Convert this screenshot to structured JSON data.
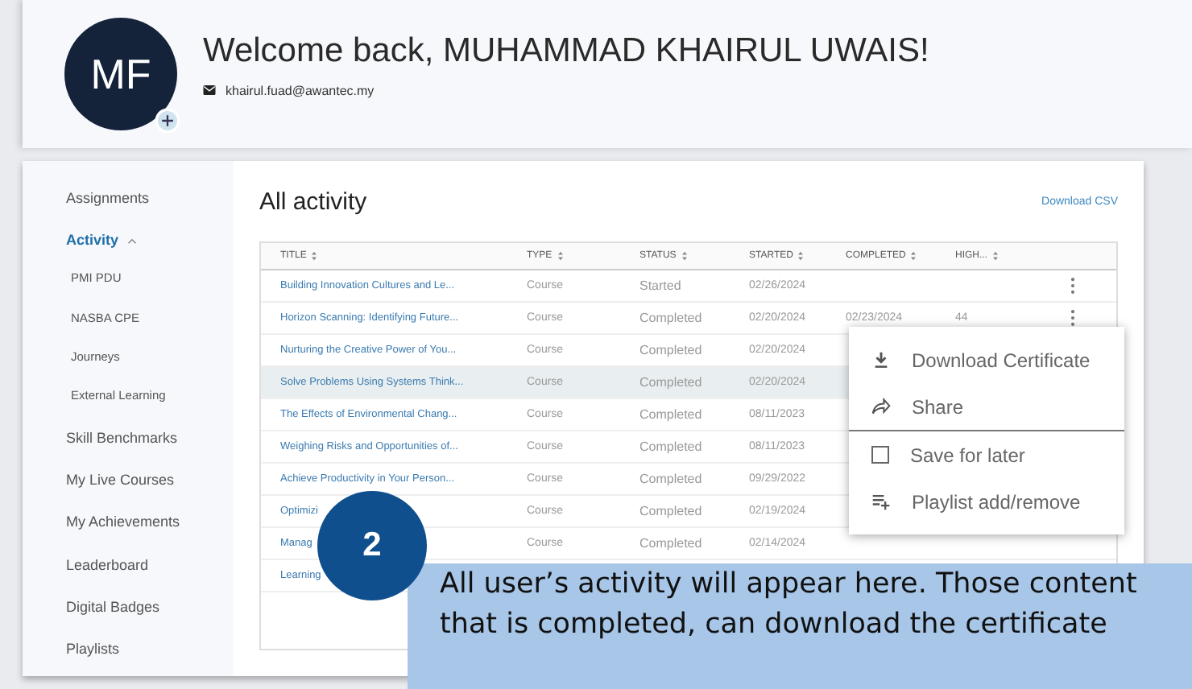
{
  "profile": {
    "initials": "MF",
    "greeting": "Welcome back, MUHAMMAD KHAIRUL UWAIS!",
    "email": "khairul.fuad@awantec.my"
  },
  "sidebar": {
    "items": [
      {
        "label": "Assignments",
        "selected": false
      },
      {
        "label": "Activity",
        "selected": true,
        "expanded": true,
        "children": [
          {
            "label": "PMI PDU",
            "selected": false
          },
          {
            "label": "NASBA CPE",
            "selected": false
          },
          {
            "label": "Journeys",
            "selected": false
          },
          {
            "label": "External Learning",
            "selected": false
          }
        ]
      },
      {
        "label": "Skill Benchmarks",
        "selected": false
      },
      {
        "label": "My Live Courses",
        "selected": false
      },
      {
        "label": "My Achievements",
        "selected": false
      },
      {
        "label": "Leaderboard",
        "selected": false
      },
      {
        "label": "Digital Badges",
        "selected": false
      },
      {
        "label": "Playlists",
        "selected": false
      }
    ]
  },
  "activity": {
    "title": "All activity",
    "download_link": "Download CSV",
    "table": {
      "columns": [
        "TITLE",
        "TYPE",
        "STATUS",
        "STARTED",
        "COMPLETED",
        "HIGH..."
      ],
      "rows": [
        {
          "cells": [
            "Building Innovation Cultures and Le...",
            "Course",
            "Started",
            "02/26/2024",
            "",
            ""
          ],
          "selected": false,
          "menu_icon": true
        },
        {
          "cells": [
            "Horizon Scanning: Identifying Future...",
            "Course",
            "Completed",
            "02/20/2024",
            "02/23/2024",
            "44"
          ],
          "selected": false,
          "menu_icon": true
        },
        {
          "cells": [
            "Nurturing the Creative Power of You...",
            "Course",
            "Completed",
            "02/20/2024",
            "",
            ""
          ],
          "selected": false,
          "menu_icon": false
        },
        {
          "cells": [
            "Solve Problems Using Systems Think...",
            "Course",
            "Completed",
            "02/20/2024",
            "",
            ""
          ],
          "selected": true,
          "menu_icon": false
        },
        {
          "cells": [
            "The Effects of Environmental Chang...",
            "Course",
            "Completed",
            "08/11/2023",
            "",
            ""
          ],
          "selected": false,
          "menu_icon": false
        },
        {
          "cells": [
            "Weighing Risks and Opportunities of...",
            "Course",
            "Completed",
            "08/11/2023",
            "",
            ""
          ],
          "selected": false,
          "menu_icon": false
        },
        {
          "cells": [
            "Achieve Productivity in Your Person...",
            "Course",
            "Completed",
            "09/29/2022",
            "",
            ""
          ],
          "selected": false,
          "menu_icon": false
        },
        {
          "cells": [
            "Optimizi",
            "Course",
            "Completed",
            "02/19/2024",
            "",
            ""
          ],
          "selected": false,
          "menu_icon": false
        },
        {
          "cells": [
            "Manag",
            "Course",
            "Completed",
            "02/14/2024",
            "",
            ""
          ],
          "selected": false,
          "menu_icon": false
        },
        {
          "cells": [
            "Learning",
            "",
            "",
            "",
            "",
            ""
          ],
          "selected": false,
          "menu_icon": false
        }
      ]
    }
  },
  "context_menu": {
    "items": [
      {
        "kind": "download",
        "label": "Download Certificate"
      },
      {
        "kind": "share",
        "label": "Share"
      },
      {
        "kind": "checkbox",
        "label": "Save for later",
        "checked": false
      },
      {
        "kind": "playlist",
        "label": "Playlist add/remove"
      }
    ]
  },
  "callout": {
    "step": "2",
    "text": "All user’s activity will appear here. Those content that is completed, can download the certificate"
  }
}
